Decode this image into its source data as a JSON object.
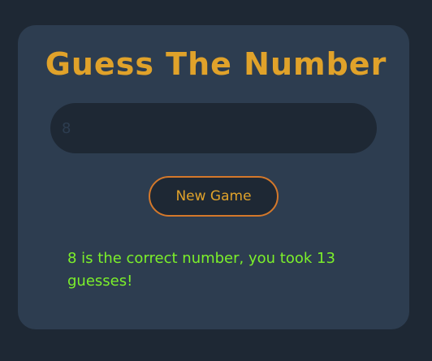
{
  "app": {
    "title": "Guess The Number"
  },
  "guess": {
    "value": "8"
  },
  "controls": {
    "new_game_label": "New Game"
  },
  "result": {
    "message": "8 is the correct number, you took 13 guesses!"
  },
  "colors": {
    "page_background": "#1e2834",
    "card_background": "#2d3d50",
    "title": "#e0a22a",
    "button_border": "#d4782a",
    "success_text": "#7cf02a"
  }
}
